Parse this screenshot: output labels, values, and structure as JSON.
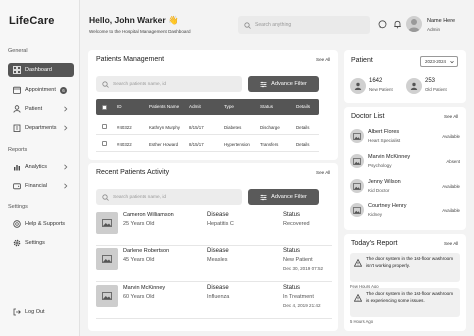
{
  "app": {
    "name": "LifeCare"
  },
  "sidebar": {
    "section_general": "General",
    "section_reports": "Reports",
    "section_settings": "Settings",
    "items": [
      {
        "label": "Dashboard",
        "icon": "dashboard-icon"
      },
      {
        "label": "Appointment",
        "icon": "calendar-icon",
        "badge": "6"
      },
      {
        "label": "Patient",
        "icon": "user-icon"
      },
      {
        "label": "Departments",
        "icon": "building-icon"
      },
      {
        "label": "Analytics",
        "icon": "chart-icon"
      },
      {
        "label": "Financial",
        "icon": "wallet-icon"
      },
      {
        "label": "Help & Supports",
        "icon": "help-icon"
      },
      {
        "label": "Settings",
        "icon": "gear-icon"
      }
    ],
    "logout": "Log Out"
  },
  "header": {
    "greeting": "Hello, John Warker 👋",
    "subtitle": "Welcome to the Hospital Management Dashboard",
    "search_placeholder": "Search anything",
    "user_name": "Name Here",
    "user_role": "Admin"
  },
  "patients_management": {
    "title": "Patients Management",
    "see_all": "See All",
    "search_placeholder": "Search patients name, id",
    "filter_button": "Advance Filter",
    "columns": [
      "ID",
      "Patients Name",
      "Admit",
      "Type",
      "Status",
      "Details"
    ],
    "rows": [
      {
        "id": "#40322",
        "name": "Kathryn Murphy",
        "admit": "8/15/17",
        "type": "Diabetes",
        "status": "Discharge",
        "details": "Details"
      },
      {
        "id": "#40322",
        "name": "Esther Howard",
        "admit": "8/15/17",
        "type": "Hypertension",
        "status": "Transfers",
        "details": "Details"
      }
    ]
  },
  "recent_activity": {
    "title": "Recent Patients Activity",
    "see_all": "See All",
    "search_placeholder": "Search patients name, id",
    "filter_button": "Advance Filter",
    "disease_header": "Disease",
    "status_header": "Status",
    "items": [
      {
        "name": "Cameron Williamson",
        "age": "25 Years Old",
        "disease": "Hepatitis C",
        "status": "Recovered",
        "date": ""
      },
      {
        "name": "Darlene Robertson",
        "age": "45 Years Old",
        "disease": "Measles",
        "status": "New Patient",
        "date": "Dec 30, 2019 07:52"
      },
      {
        "name": "Marvin McKinney",
        "age": "60 Years Old",
        "disease": "Influenza",
        "status": "In Treatment",
        "date": "Dec 4, 2019 21:42"
      }
    ]
  },
  "patient_stats": {
    "title": "Patient",
    "year": "2023-2024",
    "new_count": "1642",
    "new_label": "New Patient",
    "old_count": "253",
    "old_label": "Old Patient"
  },
  "doctor_list": {
    "title": "Doctor List",
    "see_all": "See All",
    "doctors": [
      {
        "name": "Albert Flores",
        "specialty": "Heart Specialist",
        "status": "Available"
      },
      {
        "name": "Marvin McKinney",
        "specialty": "Psychology",
        "status": "Absent"
      },
      {
        "name": "Jenny Wilson",
        "specialty": "Kid Doctor",
        "status": "Available"
      },
      {
        "name": "Courtney Henry",
        "specialty": "Kidney",
        "status": "Available"
      }
    ]
  },
  "todays_report": {
    "title": "Today's Report",
    "see_all": "See All",
    "reports": [
      {
        "text": "The door system in the 1st-floor washroom isn't working properly.",
        "time": "Few Hours Ago"
      },
      {
        "text": "The door system in the 1st-floor washroom is experiencing some issues.",
        "time": "5 Hours Ago"
      }
    ]
  }
}
